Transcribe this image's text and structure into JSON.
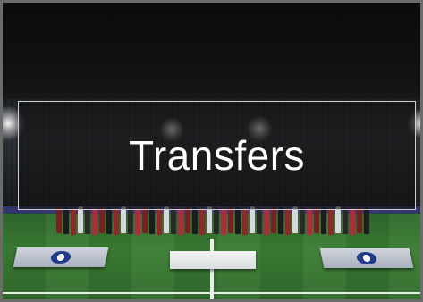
{
  "tile": {
    "title": "Transfers"
  }
}
